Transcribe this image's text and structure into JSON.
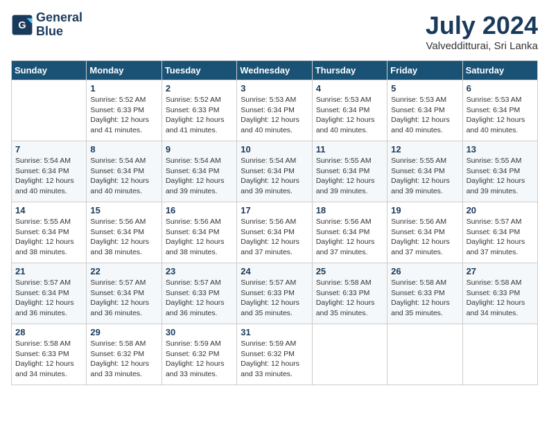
{
  "header": {
    "logo_line1": "General",
    "logo_line2": "Blue",
    "month_title": "July 2024",
    "location": "Valvedditturai, Sri Lanka"
  },
  "weekdays": [
    "Sunday",
    "Monday",
    "Tuesday",
    "Wednesday",
    "Thursday",
    "Friday",
    "Saturday"
  ],
  "weeks": [
    [
      {
        "day": "",
        "info": ""
      },
      {
        "day": "1",
        "info": "Sunrise: 5:52 AM\nSunset: 6:33 PM\nDaylight: 12 hours\nand 41 minutes."
      },
      {
        "day": "2",
        "info": "Sunrise: 5:52 AM\nSunset: 6:33 PM\nDaylight: 12 hours\nand 41 minutes."
      },
      {
        "day": "3",
        "info": "Sunrise: 5:53 AM\nSunset: 6:34 PM\nDaylight: 12 hours\nand 40 minutes."
      },
      {
        "day": "4",
        "info": "Sunrise: 5:53 AM\nSunset: 6:34 PM\nDaylight: 12 hours\nand 40 minutes."
      },
      {
        "day": "5",
        "info": "Sunrise: 5:53 AM\nSunset: 6:34 PM\nDaylight: 12 hours\nand 40 minutes."
      },
      {
        "day": "6",
        "info": "Sunrise: 5:53 AM\nSunset: 6:34 PM\nDaylight: 12 hours\nand 40 minutes."
      }
    ],
    [
      {
        "day": "7",
        "info": "Sunrise: 5:54 AM\nSunset: 6:34 PM\nDaylight: 12 hours\nand 40 minutes."
      },
      {
        "day": "8",
        "info": "Sunrise: 5:54 AM\nSunset: 6:34 PM\nDaylight: 12 hours\nand 40 minutes."
      },
      {
        "day": "9",
        "info": "Sunrise: 5:54 AM\nSunset: 6:34 PM\nDaylight: 12 hours\nand 39 minutes."
      },
      {
        "day": "10",
        "info": "Sunrise: 5:54 AM\nSunset: 6:34 PM\nDaylight: 12 hours\nand 39 minutes."
      },
      {
        "day": "11",
        "info": "Sunrise: 5:55 AM\nSunset: 6:34 PM\nDaylight: 12 hours\nand 39 minutes."
      },
      {
        "day": "12",
        "info": "Sunrise: 5:55 AM\nSunset: 6:34 PM\nDaylight: 12 hours\nand 39 minutes."
      },
      {
        "day": "13",
        "info": "Sunrise: 5:55 AM\nSunset: 6:34 PM\nDaylight: 12 hours\nand 39 minutes."
      }
    ],
    [
      {
        "day": "14",
        "info": "Sunrise: 5:55 AM\nSunset: 6:34 PM\nDaylight: 12 hours\nand 38 minutes."
      },
      {
        "day": "15",
        "info": "Sunrise: 5:56 AM\nSunset: 6:34 PM\nDaylight: 12 hours\nand 38 minutes."
      },
      {
        "day": "16",
        "info": "Sunrise: 5:56 AM\nSunset: 6:34 PM\nDaylight: 12 hours\nand 38 minutes."
      },
      {
        "day": "17",
        "info": "Sunrise: 5:56 AM\nSunset: 6:34 PM\nDaylight: 12 hours\nand 37 minutes."
      },
      {
        "day": "18",
        "info": "Sunrise: 5:56 AM\nSunset: 6:34 PM\nDaylight: 12 hours\nand 37 minutes."
      },
      {
        "day": "19",
        "info": "Sunrise: 5:56 AM\nSunset: 6:34 PM\nDaylight: 12 hours\nand 37 minutes."
      },
      {
        "day": "20",
        "info": "Sunrise: 5:57 AM\nSunset: 6:34 PM\nDaylight: 12 hours\nand 37 minutes."
      }
    ],
    [
      {
        "day": "21",
        "info": "Sunrise: 5:57 AM\nSunset: 6:34 PM\nDaylight: 12 hours\nand 36 minutes."
      },
      {
        "day": "22",
        "info": "Sunrise: 5:57 AM\nSunset: 6:34 PM\nDaylight: 12 hours\nand 36 minutes."
      },
      {
        "day": "23",
        "info": "Sunrise: 5:57 AM\nSunset: 6:33 PM\nDaylight: 12 hours\nand 36 minutes."
      },
      {
        "day": "24",
        "info": "Sunrise: 5:57 AM\nSunset: 6:33 PM\nDaylight: 12 hours\nand 35 minutes."
      },
      {
        "day": "25",
        "info": "Sunrise: 5:58 AM\nSunset: 6:33 PM\nDaylight: 12 hours\nand 35 minutes."
      },
      {
        "day": "26",
        "info": "Sunrise: 5:58 AM\nSunset: 6:33 PM\nDaylight: 12 hours\nand 35 minutes."
      },
      {
        "day": "27",
        "info": "Sunrise: 5:58 AM\nSunset: 6:33 PM\nDaylight: 12 hours\nand 34 minutes."
      }
    ],
    [
      {
        "day": "28",
        "info": "Sunrise: 5:58 AM\nSunset: 6:33 PM\nDaylight: 12 hours\nand 34 minutes."
      },
      {
        "day": "29",
        "info": "Sunrise: 5:58 AM\nSunset: 6:32 PM\nDaylight: 12 hours\nand 33 minutes."
      },
      {
        "day": "30",
        "info": "Sunrise: 5:59 AM\nSunset: 6:32 PM\nDaylight: 12 hours\nand 33 minutes."
      },
      {
        "day": "31",
        "info": "Sunrise: 5:59 AM\nSunset: 6:32 PM\nDaylight: 12 hours\nand 33 minutes."
      },
      {
        "day": "",
        "info": ""
      },
      {
        "day": "",
        "info": ""
      },
      {
        "day": "",
        "info": ""
      }
    ]
  ]
}
